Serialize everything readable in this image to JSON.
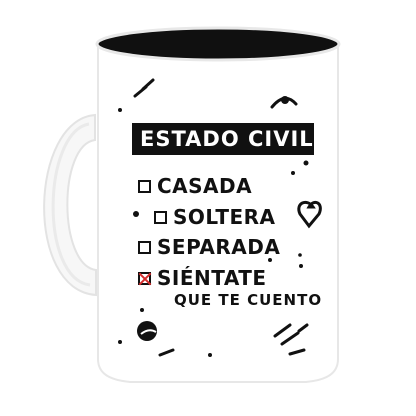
{
  "mug": {
    "title": "ESTADO CIVIL:",
    "options": [
      {
        "label": "CASADA",
        "checked": false
      },
      {
        "label": "SOLTERA",
        "checked": false
      },
      {
        "label": "SEPARADA",
        "checked": false
      },
      {
        "label": "SIÉNTATE",
        "checked": true
      }
    ],
    "subtitle": "QUE TE CUENTO"
  },
  "icons": [
    "heart-icon",
    "circle-icon",
    "slash-icon",
    "dot-icon",
    "planet-icon"
  ],
  "colors": {
    "mug": "#ffffff",
    "inner": "#111111",
    "text": "#111111",
    "accent": "#d52d2d"
  }
}
